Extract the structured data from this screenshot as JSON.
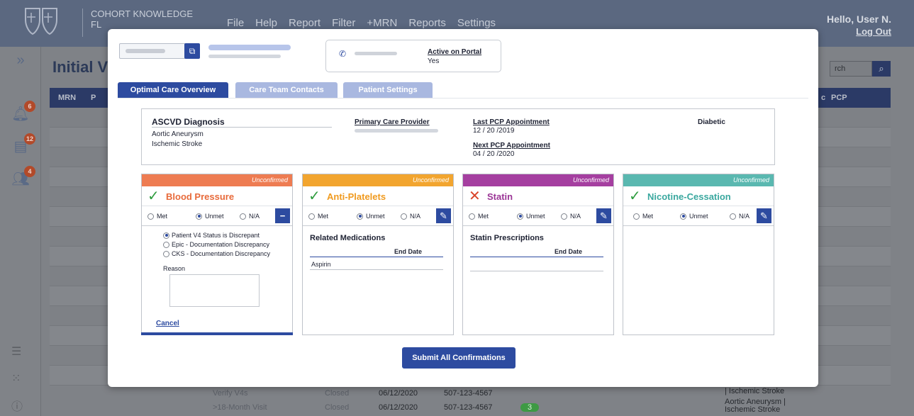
{
  "app": {
    "brand_line1": "COHORT KNOWLEDGE",
    "brand_line2": "FL",
    "menu": [
      "File",
      "Help",
      "Report",
      "Filter",
      "+MRN",
      "Reports",
      "Settings"
    ],
    "greeting": "Hello, User N.",
    "logout": "Log Out",
    "rail_badges": {
      "notifications": "6",
      "documents": "12",
      "users": "4"
    },
    "page_title": "Initial V",
    "search_placeholder": "rch",
    "table_headers": {
      "mrn": "MRN",
      "p": "P",
      "c": "c",
      "pcp": "PCP"
    },
    "bottom_rows": [
      {
        "visit": "Verify V4s",
        "status": "Closed",
        "date": "06/12/2020",
        "phone": "507-123-4567",
        "dx": "| Ischemic Stroke"
      },
      {
        "visit": ">18-Month Visit",
        "status": "Closed",
        "date": "06/12/2020",
        "phone": "507-123-4567",
        "count": "3",
        "dx": "Aortic Aneurysm | Ischemic Stroke"
      }
    ]
  },
  "modal": {
    "portal_label": "Active on Portal",
    "portal_value": "Yes",
    "tabs": [
      "Optimal Care Overview",
      "Care Team Contacts",
      "Patient Settings"
    ],
    "summary": {
      "ascvd_title": "ASCVD Diagnosis",
      "diagnoses": [
        "Aortic Aneurysm",
        "Ischemic Stroke"
      ],
      "pcp_label": "Primary Care Provider",
      "last_pcp_label": "Last PCP Appointment",
      "last_pcp_value": "12 / 20 /2019",
      "next_pcp_label": "Next PCP Appointment",
      "next_pcp_value": "04 / 20 /2020",
      "diabetic_label": "Diabetic"
    },
    "radio_labels": {
      "met": "Met",
      "unmet": "Unmet",
      "na": "N/A"
    },
    "measures": [
      {
        "name": "Blood Pressure",
        "badge": "Unconfirmed",
        "status": "met",
        "header_color": "#ee7c52",
        "name_color": "#e86a3a",
        "selected": "unmet",
        "action": "minus",
        "reasons": [
          "Patient V4 Status is Discrepant",
          "Epic - Documentation Discrepancy",
          "CKS - Documentation Discrepancy"
        ],
        "reason_selected": 0,
        "reason_label": "Reason",
        "cancel": "Cancel"
      },
      {
        "name": "Anti-Platelets",
        "badge": "Unconfirmed",
        "status": "met",
        "header_color": "#f2a52f",
        "name_color": "#f09a1e",
        "selected": "unmet",
        "action": "edit",
        "section_title": "Related Medications",
        "col_header": "End Date",
        "rows": [
          "Aspirin"
        ]
      },
      {
        "name": "Statin",
        "badge": "Unconfirmed",
        "status": "unmet",
        "header_color": "#a53fa0",
        "name_color": "#9b3596",
        "selected": "unmet",
        "action": "edit",
        "section_title": "Statin Prescriptions",
        "col_header": "End Date",
        "rows": []
      },
      {
        "name": "Nicotine-Cessation",
        "badge": "Unconfirmed",
        "status": "met",
        "header_color": "#5ab8b0",
        "name_color": "#3aa89f",
        "selected": "unmet",
        "action": "edit"
      }
    ],
    "submit": "Submit All Confirmations"
  }
}
